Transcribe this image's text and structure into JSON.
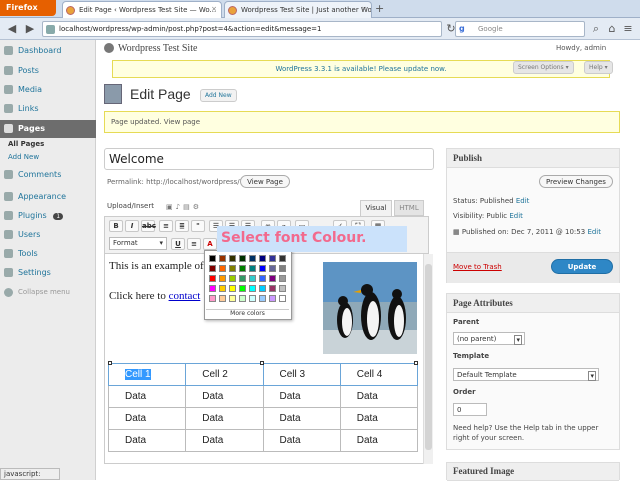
{
  "browser": {
    "app_button": "Firefox",
    "tabs": [
      {
        "label": "Edit Page ‹ Wordpress Test Site — Wo..."
      },
      {
        "label": "Wordpress Test Site | Just another Wo..."
      }
    ],
    "new_tab": "+",
    "url": "localhost/wordpress/wp-admin/post.php?post=4&action=edit&message=1",
    "search_placeholder": "Google",
    "status_text": "javascript:"
  },
  "sidebar": {
    "items": [
      {
        "label": "Dashboard"
      },
      {
        "label": "Posts"
      },
      {
        "label": "Media"
      },
      {
        "label": "Links"
      },
      {
        "label": "Pages"
      },
      {
        "label": "Comments"
      },
      {
        "label": "Appearance"
      },
      {
        "label": "Plugins",
        "badge": "1"
      },
      {
        "label": "Users"
      },
      {
        "label": "Tools"
      },
      {
        "label": "Settings"
      }
    ],
    "submenu": [
      "All Pages",
      "Add New"
    ],
    "collapse": "Collapse menu"
  },
  "header": {
    "site_name": "Wordpress Test Site",
    "howdy": "Howdy, admin",
    "update_notice": "WordPress 3.3.1 is available! Please update now.",
    "screen_options": "Screen Options ▾",
    "help": "Help ▾",
    "page_title": "Edit Page",
    "add_new": "Add New",
    "message": "Page updated. View page"
  },
  "editor": {
    "title": "Welcome",
    "permalink": "Permalink: http://localhost/wordpress/?page_id=2",
    "edit_button": "View Page",
    "upload_insert": "Upload/Insert",
    "tab_visual": "Visual",
    "tab_html": "HTML",
    "format_select": "Format",
    "para1": "This is an example of",
    "para2": "Click here to",
    "para2_link": "contact",
    "table": [
      [
        "Cell 1",
        "Cell 2",
        "Cell 3",
        "Cell 4"
      ],
      [
        "Data",
        "Data",
        "Data",
        "Data"
      ],
      [
        "Data",
        "Data",
        "Data",
        "Data"
      ],
      [
        "Data",
        "Data",
        "Data",
        "Data"
      ]
    ],
    "more_colors": "More colors",
    "callout": "Select font Colour.",
    "colors": [
      "#000000",
      "#993300",
      "#333300",
      "#003300",
      "#003366",
      "#000080",
      "#333399",
      "#333333",
      "#800000",
      "#ff6600",
      "#808000",
      "#008000",
      "#008080",
      "#0000ff",
      "#666699",
      "#808080",
      "#ff0000",
      "#ff9900",
      "#99cc00",
      "#339966",
      "#33cccc",
      "#3366ff",
      "#800080",
      "#999999",
      "#ff00ff",
      "#ffcc00",
      "#ffff00",
      "#00ff00",
      "#00ffff",
      "#00ccff",
      "#993366",
      "#c0c0c0",
      "#ff99cc",
      "#ffcc99",
      "#ffff99",
      "#ccffcc",
      "#ccffff",
      "#99ccff",
      "#cc99ff",
      "#ffffff"
    ]
  },
  "publish": {
    "title": "Publish",
    "preview": "Preview Changes",
    "status": "Status: Published",
    "status_edit": "Edit",
    "visibility": "Visibility: Public",
    "visibility_edit": "Edit",
    "published_on": "Published on: Dec 7, 2011 @ 10:53",
    "published_edit": "Edit",
    "trash": "Move to Trash",
    "update": "Update"
  },
  "attributes": {
    "title": "Page Attributes",
    "parent_label": "Parent",
    "parent_value": "(no parent)",
    "template_label": "Template",
    "template_value": "Default Template",
    "order_label": "Order",
    "order_value": "0",
    "help": "Need help? Use the Help tab in the upper right of your screen."
  },
  "featured": {
    "title": "Featured Image"
  }
}
